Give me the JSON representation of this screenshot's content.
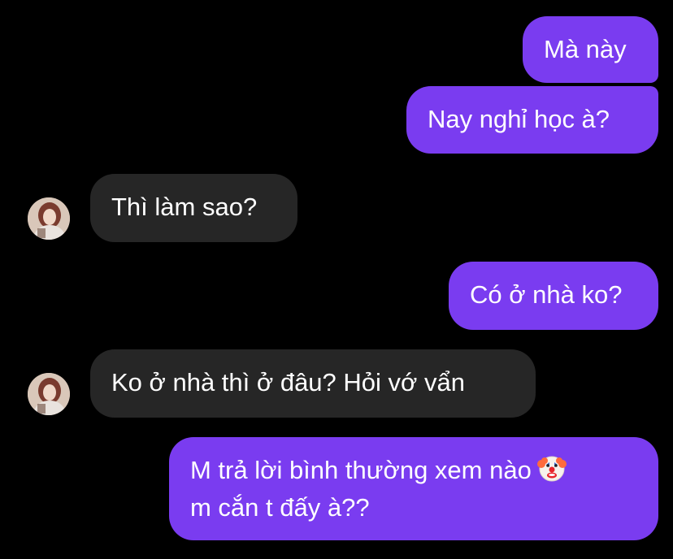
{
  "conversation": {
    "messages": [
      {
        "from": "me",
        "text": "Mà này"
      },
      {
        "from": "me",
        "text": "Nay nghỉ học à?"
      },
      {
        "from": "other",
        "text": "Thì làm sao?"
      },
      {
        "from": "me",
        "text": "Có ở nhà ko?"
      },
      {
        "from": "other",
        "text": "Ko ở nhà thì ở đâu? Hỏi vớ vẩn"
      },
      {
        "from": "me",
        "line1": "M trả lời bình thường xem nào",
        "line1_emoji": "clown-face-emoji",
        "line2": "m cắn t đấy à??"
      }
    ]
  },
  "colors": {
    "background": "#000000",
    "sent_bubble": "#7a3cf0",
    "received_bubble": "#262626",
    "text": "#ffffff"
  }
}
